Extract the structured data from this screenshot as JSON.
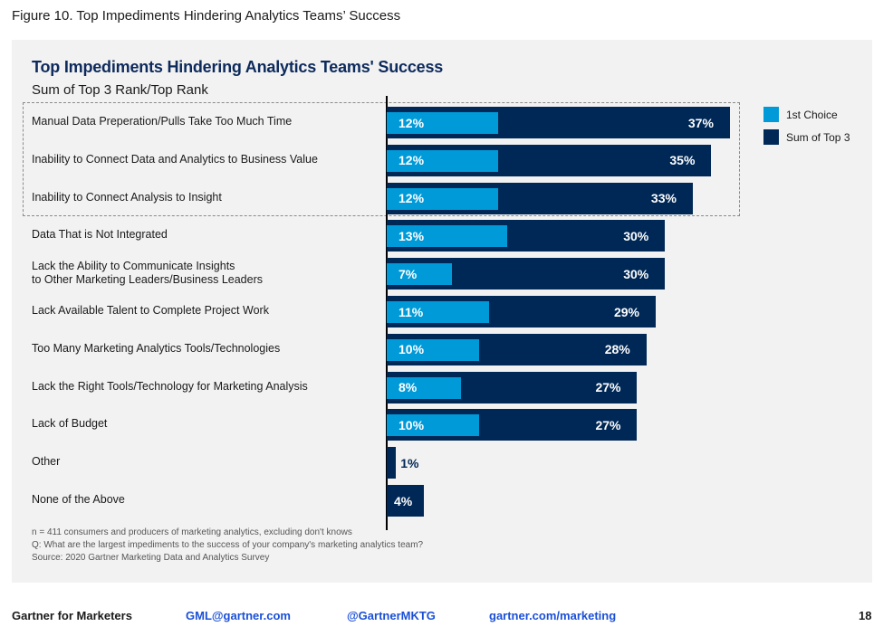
{
  "figure_caption": "Figure 10. Top Impediments Hindering Analytics Teams’ Success",
  "colors": {
    "first_choice": "#009ad8",
    "sum_top3": "#002856",
    "title": "#0d2a5c",
    "link": "#1a4fd6"
  },
  "chart_data": {
    "type": "bar",
    "orientation": "horizontal",
    "title": "Top Impediments Hindering Analytics Teams' Success",
    "subtitle": "Sum of Top 3 Rank/Top Rank",
    "xlabel": "",
    "ylabel": "",
    "value_suffix": "%",
    "xlim": [
      0,
      40
    ],
    "grid": false,
    "legend_position": "top-right",
    "highlighted_categories": 3,
    "categories": [
      "Manual Data Preperation/Pulls Take Too Much Time",
      "Inability to Connect Data and Analytics to Business Value",
      "Inability to Connect Analysis to Insight",
      "Data That is Not Integrated",
      "Lack the Ability to Communicate Insights\nto Other Marketing Leaders/Business Leaders",
      "Lack Available Talent to Complete Project Work",
      "Too Many Marketing Analytics Tools/Technologies",
      "Lack the Right Tools/Technology for Marketing Analysis",
      "Lack of Budget",
      "Other",
      "None of the Above"
    ],
    "series": [
      {
        "name": "1st Choice",
        "values": [
          12,
          12,
          12,
          13,
          7,
          11,
          10,
          8,
          10,
          null,
          null
        ]
      },
      {
        "name": "Sum of Top 3",
        "values": [
          37,
          35,
          33,
          30,
          30,
          29,
          28,
          27,
          27,
          1,
          4
        ]
      }
    ]
  },
  "legend": [
    {
      "label": "1st Choice"
    },
    {
      "label": "Sum of Top 3"
    }
  ],
  "notes": [
    "n = 411 consumers and producers of marketing analytics, excluding don't knows",
    "Q: What are the largest impediments to the success of your company's marketing analytics team?",
    "Source: 2020 Gartner Marketing Data and Analytics Survey"
  ],
  "footer": {
    "brand": "Gartner for Marketers",
    "email": "GML@gartner.com",
    "twitter": "@GartnerMKTG",
    "website": "gartner.com/marketing",
    "page_number": "18"
  }
}
